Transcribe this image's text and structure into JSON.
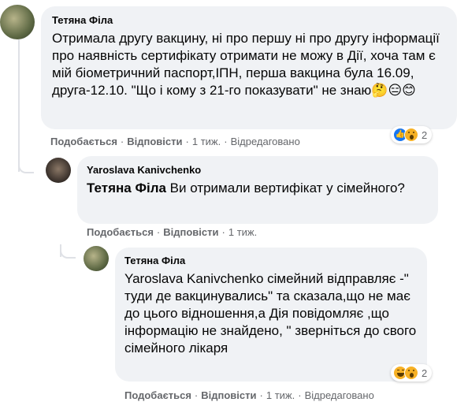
{
  "comments": [
    {
      "author": "Тетяна Філа",
      "text": "Отримала другу вакцину, ні про першу ні про другу інформації про наявність сертифікату отримати не можу в Дії, хоча там є мій біометричний паспорт,ІПН, перша вакцина була 16.09, друга-12.10. \"Що і кому з 21-го показувати\" не знаю🤔😑😊",
      "actions": {
        "like": "Подобається",
        "reply": "Відповісти",
        "time": "1 тиж.",
        "edited": "Відредаговано"
      },
      "reactions": {
        "icons": [
          "like-icon",
          "wow-icon"
        ],
        "count": "2"
      }
    },
    {
      "author": "Yaroslava Kanivchenko",
      "mention": "Тетяна Філа",
      "text": " Ви отримали вертифікат у сімейного?",
      "actions": {
        "like": "Подобається",
        "reply": "Відповісти",
        "time": "1 тиж."
      }
    },
    {
      "author": "Тетяна Філа",
      "text": "Yaroslava Kanivchenko сімейний відправляє -\" туди де вакцинувались\" та сказала,що не має до цього відношення,а Дія повідомляє ,що інформацію не знайдено, \" зверніться до свого сімейного лікаря",
      "actions": {
        "like": "Подобається",
        "reply": "Відповісти",
        "time": "1 тиж.",
        "edited": "Відредаговано"
      },
      "reactions": {
        "icons": [
          "haha-icon",
          "wow-icon"
        ],
        "count": "2"
      }
    }
  ],
  "colors": {
    "bubble": "#f0f2f5",
    "meta": "#65676b",
    "text": "#050505",
    "like": "#1877f2"
  }
}
